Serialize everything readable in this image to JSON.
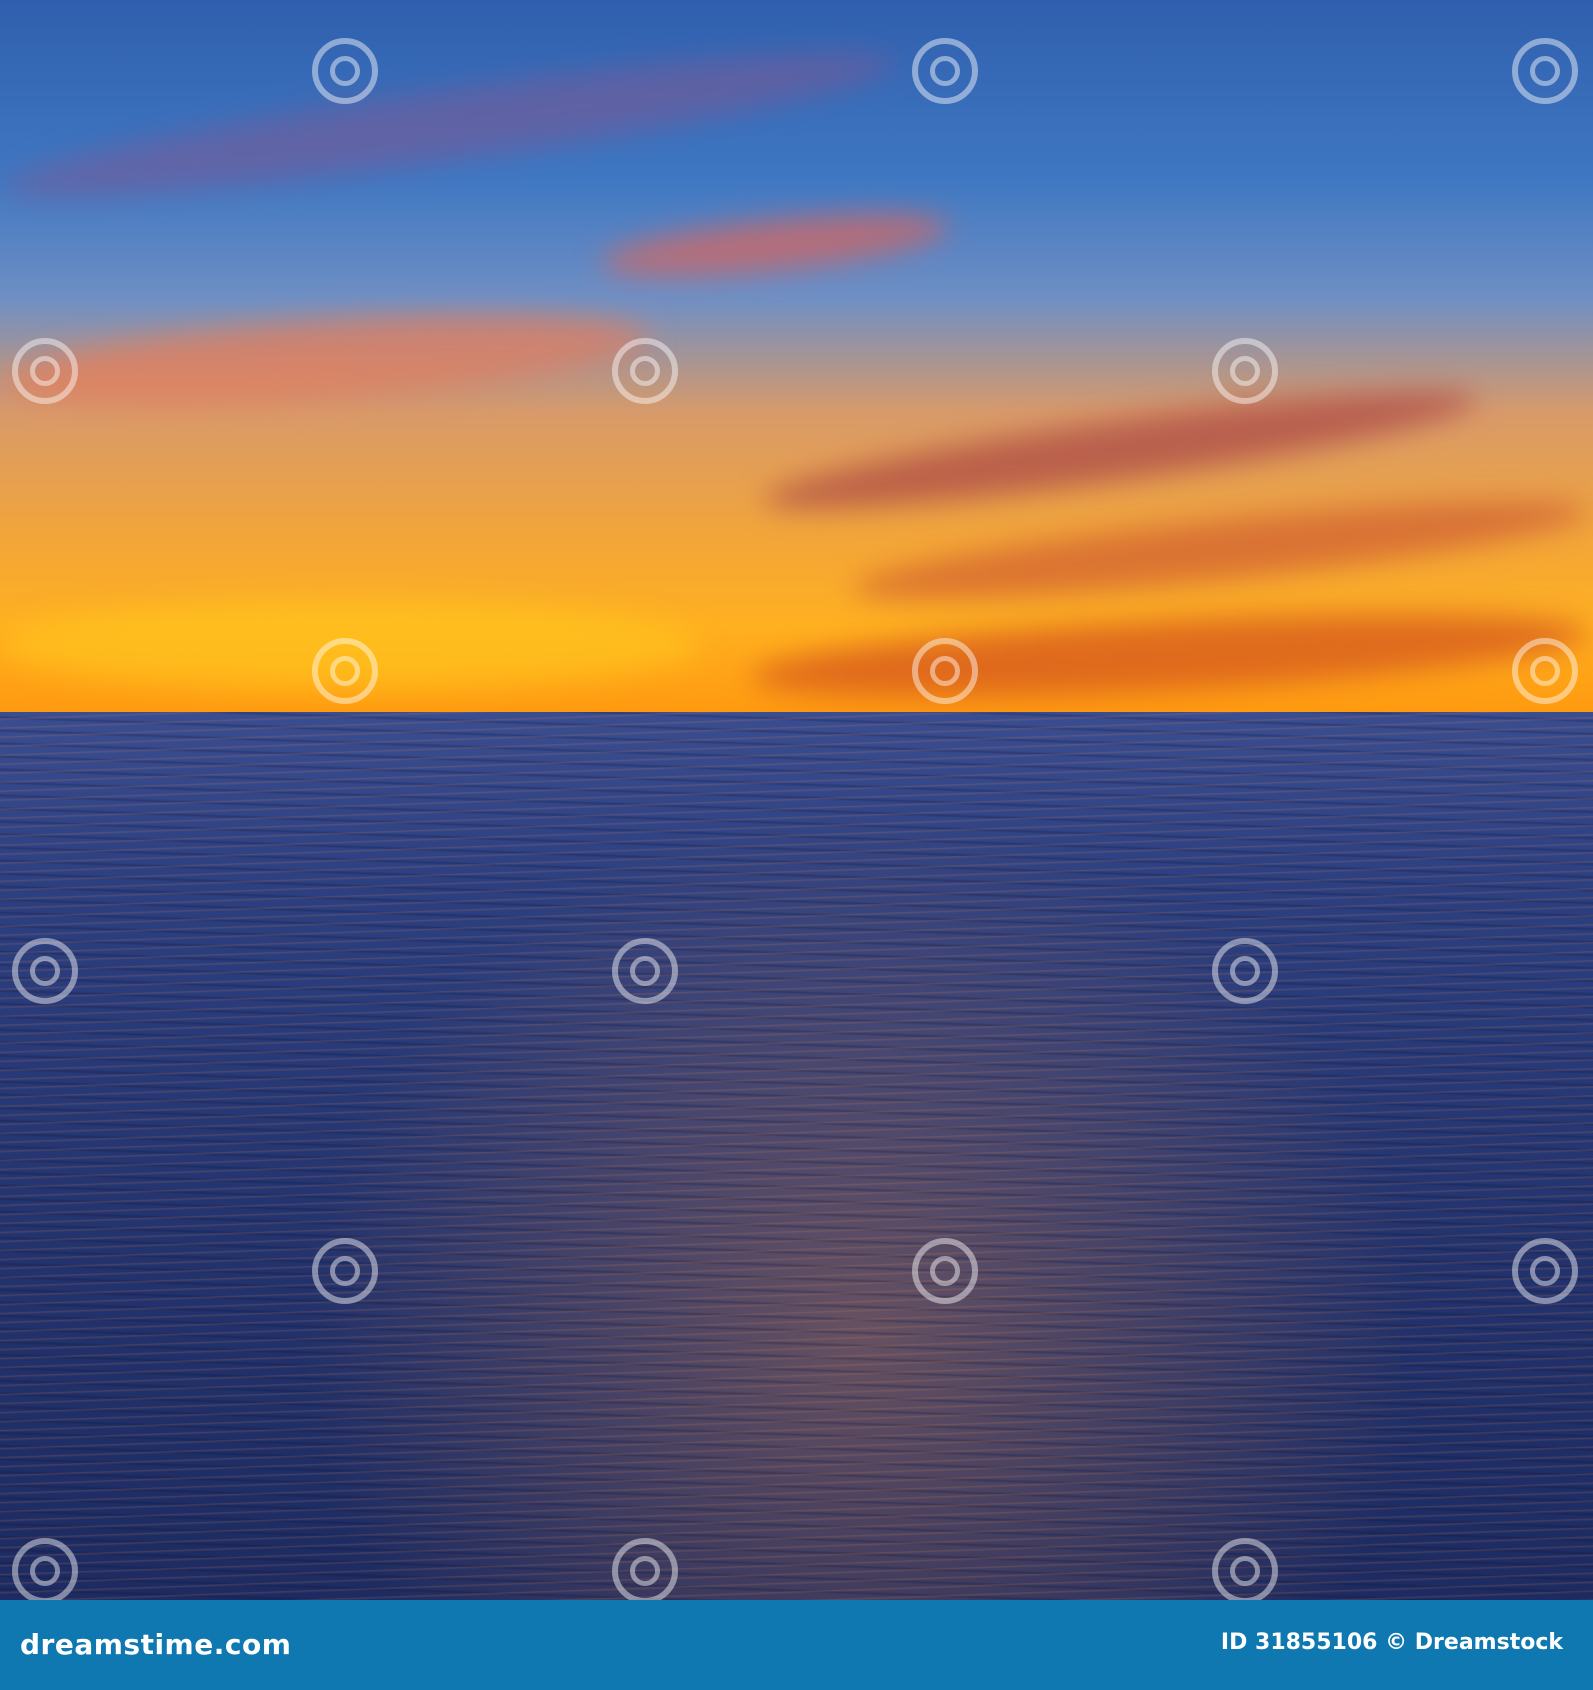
{
  "photo": {
    "subject": "sunset over the sea"
  },
  "footer": {
    "logo": "dreamstime.com",
    "credit": "ID 31855106 © Dreamstock"
  },
  "watermark": {
    "text": "dreamstime"
  },
  "colors": {
    "footer": "#0f78b0",
    "sky_top": "#2f5fae",
    "horizon": "#ffb020",
    "sea": "#23336e"
  }
}
